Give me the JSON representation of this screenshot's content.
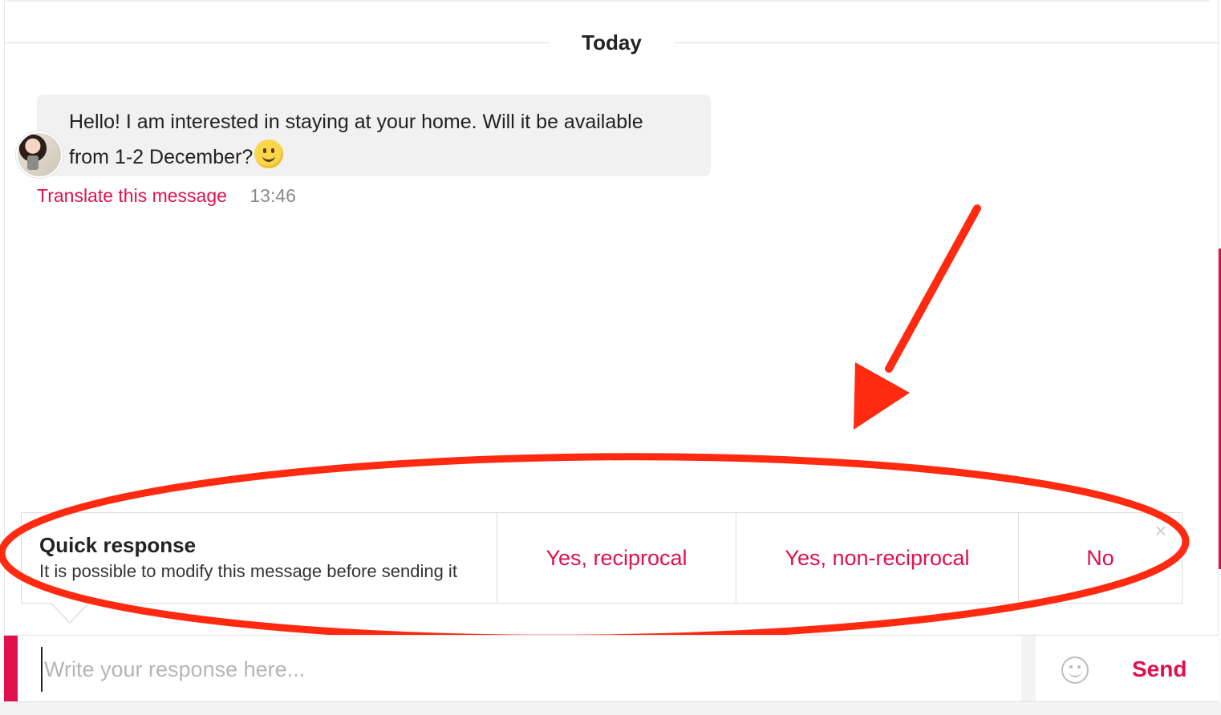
{
  "conversation": {
    "date_label": "Today",
    "message": {
      "text": "Hello! I am interested in staying at your home. Will it be available from 1-2 December?",
      "emoji": "slightly-smiling-face",
      "translate_label": "Translate this message",
      "time": "13:46"
    }
  },
  "quick_response": {
    "title": "Quick response",
    "subtitle": "It is possible to modify this message before sending it",
    "options": [
      {
        "label": "Yes, reciprocal"
      },
      {
        "label": "Yes, non-reciprocal"
      },
      {
        "label": "No"
      }
    ],
    "close_icon": "close-icon"
  },
  "composer": {
    "placeholder": "Write your response here...",
    "emoji_icon": "smiley-icon",
    "send_label": "Send"
  },
  "colors": {
    "accent": "#e0104f",
    "annotation": "#ff2a10",
    "bubble": "#f1f1f1"
  }
}
